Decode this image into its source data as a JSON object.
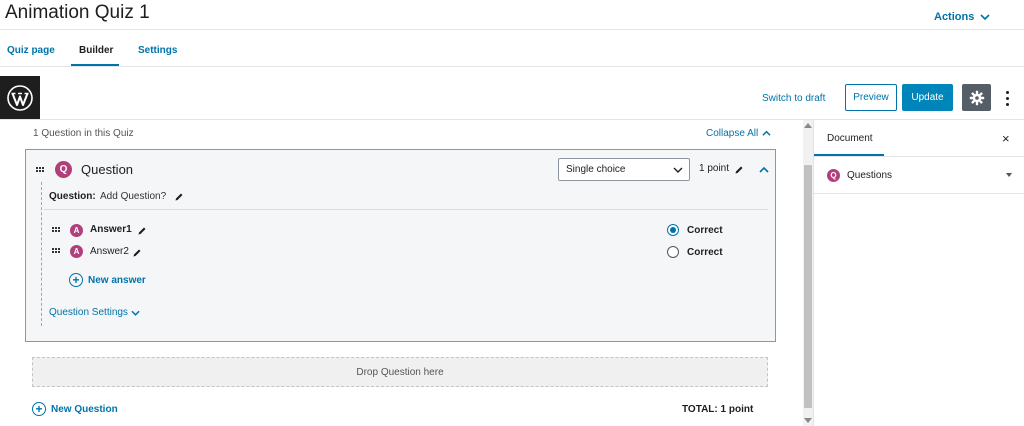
{
  "header": {
    "title": "Animation Quiz 1",
    "actions_label": "Actions"
  },
  "tabs": [
    {
      "label": "Quiz page"
    },
    {
      "label": "Builder"
    },
    {
      "label": "Settings"
    }
  ],
  "toolbar": {
    "switch_to_draft": "Switch to draft",
    "preview": "Preview",
    "update": "Update"
  },
  "builder": {
    "question_count": "1 Question in this Quiz",
    "collapse_all": "Collapse All",
    "question": {
      "badge": "Q",
      "title": "Question",
      "type_selected": "Single choice",
      "points": "1 point",
      "label": "Question:",
      "text": "Add Question?",
      "answers": [
        {
          "badge": "A",
          "name": "Answer1",
          "correct_label": "Correct",
          "correct": true
        },
        {
          "badge": "A",
          "name": "Answer2",
          "correct_label": "Correct",
          "correct": false
        }
      ],
      "new_answer": "New answer",
      "settings": "Question Settings"
    },
    "drop_zone": "Drop Question here",
    "new_question": "New Question",
    "total": "TOTAL: 1 point"
  },
  "sidebar": {
    "tab": "Document",
    "close": "×",
    "section_badge": "Q",
    "section": "Questions"
  },
  "colors": {
    "accent": "#0073aa",
    "badge": "#b03f7b",
    "update_button": "#0085ba",
    "gear_button": "#555d66"
  }
}
